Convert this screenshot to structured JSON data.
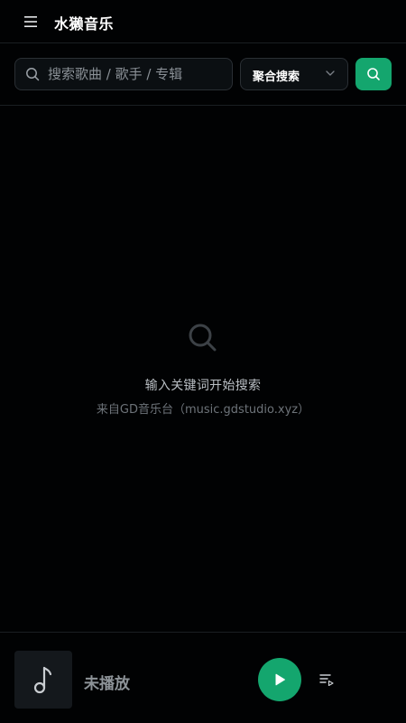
{
  "header": {
    "title": "水獭音乐",
    "menu_icon": "hamburger-menu-icon"
  },
  "search": {
    "placeholder": "搜索歌曲 / 歌手 / 专辑",
    "value": "",
    "mode": "聚合搜索",
    "search_icon": "search-icon",
    "dropdown_icon": "chevron-down-icon"
  },
  "empty_state": {
    "icon": "search-icon",
    "title": "输入关键词开始搜索",
    "subtitle": "来自GD音乐台（music.gdstudio.xyz）"
  },
  "player": {
    "cover_icon": "music-note-icon",
    "now_playing": "未播放",
    "play_icon": "play-icon",
    "queue_icon": "playlist-icon"
  },
  "colors": {
    "accent": "#14a66e",
    "background": "#010203",
    "border": "#1a1e22"
  }
}
